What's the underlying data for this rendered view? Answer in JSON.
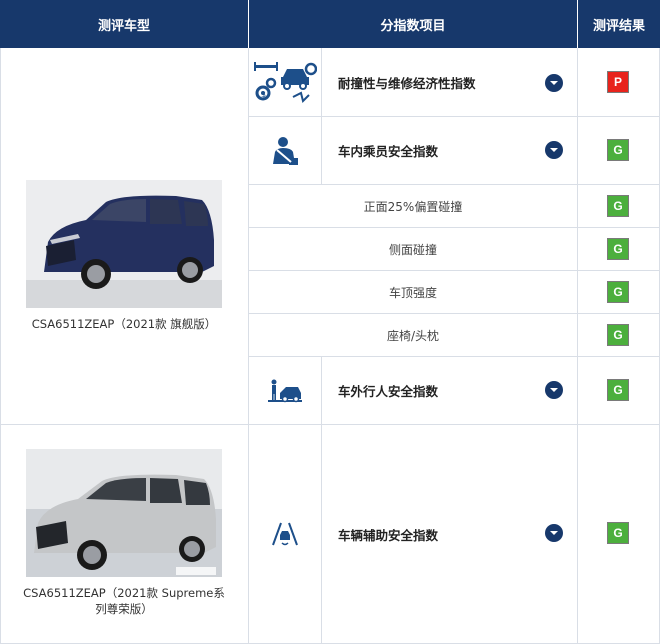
{
  "header": {
    "col_model": "测评车型",
    "col_item": "分指数项目",
    "col_result": "测评结果"
  },
  "colors": {
    "header_bg": "#17386b",
    "badge_good": "#4caf3d",
    "badge_poor": "#e8231c"
  },
  "cars": [
    {
      "name": "CSA6511ZEAP（2021款 旗舰版）",
      "image_icon": "navy-blue-mpv-photo",
      "items": [
        {
          "label": "耐撞性与维修经济性指数",
          "icon": "crash-repair-cost-icon",
          "result": "P",
          "expandable": true
        },
        {
          "label": "车内乘员安全指数",
          "icon": "occupant-seatbelt-icon",
          "result": "G",
          "expandable": true,
          "sub_items": [
            {
              "label": "正面25%偏置碰撞",
              "result": "G"
            },
            {
              "label": "侧面碰撞",
              "result": "G"
            },
            {
              "label": "车顶强度",
              "result": "G"
            },
            {
              "label": "座椅/头枕",
              "result": "G"
            }
          ]
        },
        {
          "label": "车外行人安全指数",
          "icon": "pedestrian-car-icon",
          "result": "G",
          "expandable": true
        }
      ]
    },
    {
      "name_line1": "CSA6511ZEAP（2021款 Supreme系",
      "name_line2": "列尊荣版）",
      "image_icon": "silver-mpv-photo",
      "items": [
        {
          "label": "车辆辅助安全指数",
          "icon": "lane-assist-icon",
          "result": "G",
          "expandable": true
        }
      ]
    }
  ]
}
